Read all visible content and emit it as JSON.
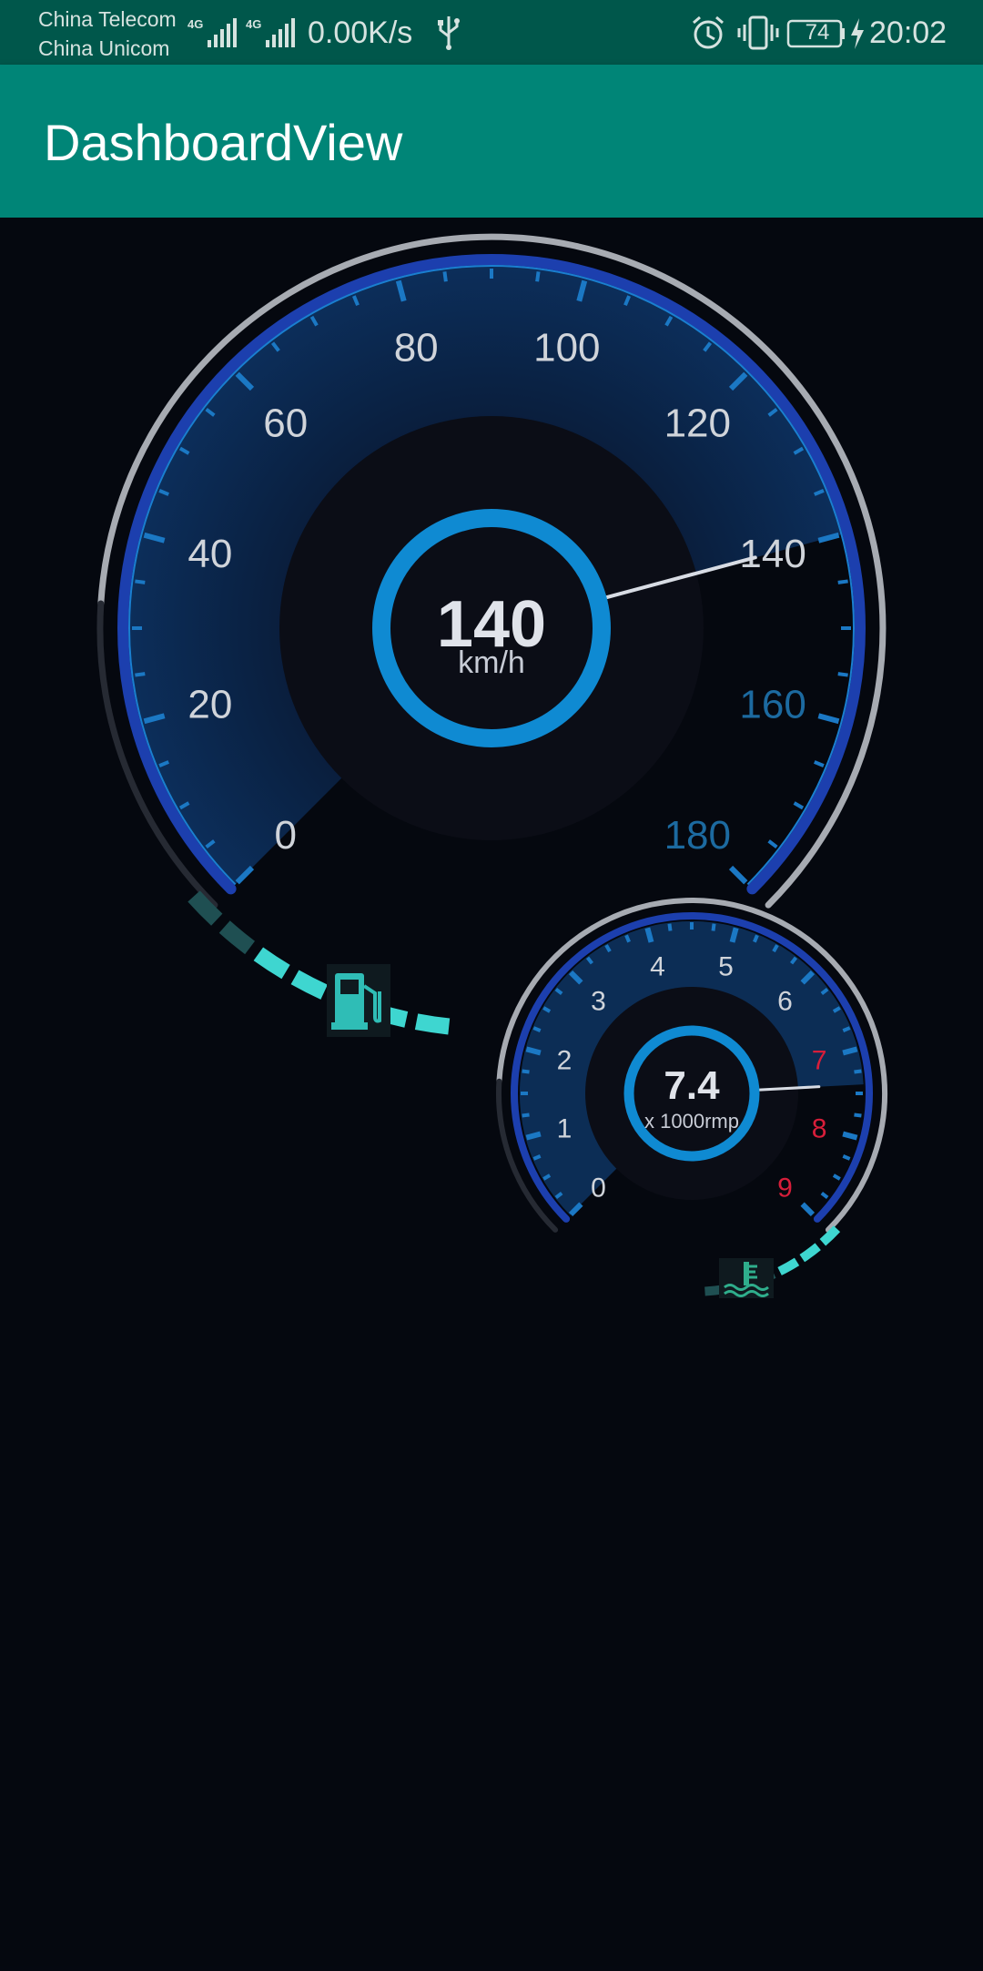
{
  "status_bar": {
    "carrier_1": "China Telecom",
    "carrier_2": "China Unicom",
    "network_speed": "0.00K/s",
    "battery_level": "74",
    "time": "20:02",
    "icons": [
      "signal-4g-icon",
      "signal-4g-icon",
      "usb-icon",
      "alarm-icon",
      "vibrate-icon",
      "battery-icon",
      "charging-icon"
    ]
  },
  "app_bar": {
    "title": "DashboardView"
  },
  "speedometer": {
    "value": "140",
    "unit": "km/h",
    "needle_value": 140,
    "min": 0,
    "max": 180,
    "labels": [
      "0",
      "20",
      "40",
      "60",
      "80",
      "100",
      "120",
      "140",
      "160",
      "180"
    ],
    "fuel_icon": "fuel-pump-icon",
    "colors": {
      "ring": "#1e40b0",
      "hub": "#0d8ad0",
      "label": "#d0d4da",
      "label_dim": "#1c6aa0",
      "fuel": "#3ed6d0"
    }
  },
  "tachometer": {
    "value": "7.4",
    "unit": "x 1000rmp",
    "needle_value": 7.4,
    "min": 0,
    "max": 9,
    "labels": [
      "0",
      "1",
      "2",
      "3",
      "4",
      "5",
      "6",
      "7",
      "8",
      "9"
    ],
    "redline_from": 7,
    "temp_icon": "coolant-temperature-icon",
    "colors": {
      "redline": "#d81e3a"
    }
  }
}
